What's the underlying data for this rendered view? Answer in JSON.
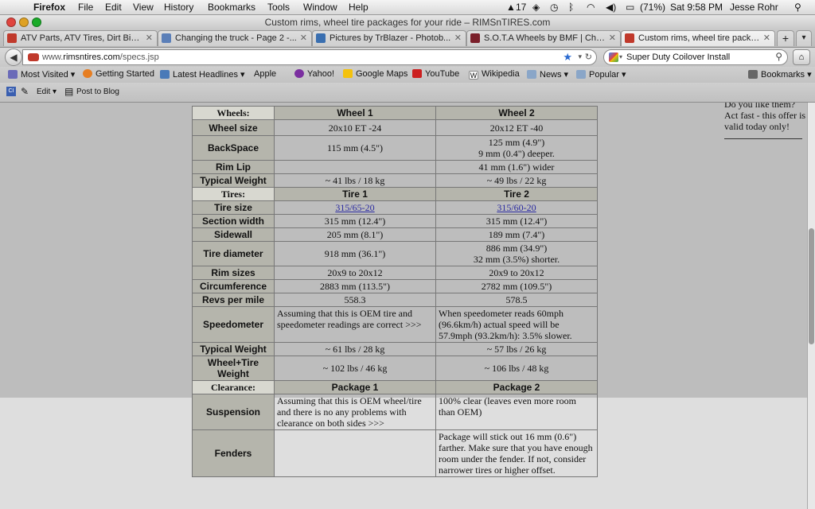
{
  "menubar": {
    "app": "Firefox",
    "items": [
      "File",
      "Edit",
      "View",
      "History",
      "Bookmarks",
      "Tools",
      "Window",
      "Help"
    ],
    "status": {
      "badge": "17",
      "battery": "(71%)",
      "clock": "Sat 9:58 PM",
      "user": "Jesse Rohr"
    }
  },
  "window": {
    "title": "Custom rims, wheel tire packages for your ride – RIMSnTIRES.com"
  },
  "tabs": [
    {
      "label": "ATV Parts, ATV Tires, Dirt Bike...",
      "color": "#c0392b"
    },
    {
      "label": "Changing the truck - Page 2 -...",
      "color": "#5b7fb8"
    },
    {
      "label": "Pictures by TrBlazer - Photob...",
      "color": "#3a6fb0"
    },
    {
      "label": "S.O.T.A Wheels by BMF | Chro...",
      "color": "#7a1f2a"
    },
    {
      "label": "Custom rims, wheel tire packa...",
      "color": "#c0392b"
    }
  ],
  "nav": {
    "url_prefix": "www.",
    "url_domain": "rimsntires.com",
    "url_path": "/specs.jsp",
    "search": "Super Duty Coilover Install"
  },
  "bookmarks": [
    {
      "label": "Most Visited ▾",
      "color": "#6a6ab8"
    },
    {
      "label": "Getting Started",
      "color": "#e67e22"
    },
    {
      "label": "Latest Headlines ▾",
      "color": "#4a7ab8"
    },
    {
      "label": "Apple",
      "color": "#555555"
    },
    {
      "label": "Yahoo!",
      "color": "#7b2fa0"
    },
    {
      "label": "Google Maps",
      "color": "#f4c20d"
    },
    {
      "label": "YouTube",
      "color": "#cc2020"
    },
    {
      "label": "Wikipedia",
      "color": "#ffffff"
    },
    {
      "label": "News ▾",
      "color": "#8aa6c8"
    },
    {
      "label": "Popular ▾",
      "color": "#8aa6c8"
    }
  ],
  "bookmarks_menu": "Bookmarks ▾",
  "toolbar2": {
    "edit": "Edit ▾",
    "post": "Post to Blog"
  },
  "sidebar": {
    "text": "Do you like them? Act fast - this offer is valid today only!"
  },
  "wheels": {
    "section": "Wheels:",
    "col1": "Wheel 1",
    "col2": "Wheel 2",
    "rows": [
      {
        "label": "Wheel size",
        "v1": "20x10 ET -24",
        "v2": "20x12 ET -40"
      },
      {
        "label": "BackSpace",
        "v1": "115 mm (4.5\")",
        "v2": "125 mm (4.9\")",
        "v2b": "9 mm (0.4\") deeper."
      },
      {
        "label": "Rim Lip",
        "v1": "",
        "v2": "41 mm (1.6\") wider"
      },
      {
        "label": "Typical Weight",
        "v1": "~ 41 lbs / 18 kg",
        "v2": "~ 49 lbs / 22 kg"
      }
    ]
  },
  "tires": {
    "section": "Tires:",
    "col1": "Tire 1",
    "col2": "Tire 2",
    "rows": [
      {
        "label": "Tire size",
        "v1": "315/65-20",
        "v2": "315/60-20"
      },
      {
        "label": "Section width",
        "v1": "315 mm (12.4\")",
        "v2": "315 mm (12.4\")"
      },
      {
        "label": "Sidewall",
        "v1": "205 mm (8.1\")",
        "v2": "189 mm (7.4\")"
      },
      {
        "label": "Tire diameter",
        "v1": "918 mm (36.1\")",
        "v2": "886 mm (34.9\")",
        "v2b": "32 mm (3.5%) shorter."
      },
      {
        "label": "Rim sizes",
        "v1": "20x9 to 20x12",
        "v2": "20x9 to 20x12"
      },
      {
        "label": "Circumference",
        "v1": "2883 mm (113.5\")",
        "v2": "2782 mm (109.5\")"
      },
      {
        "label": "Revs per mile",
        "v1": "558.3",
        "v2": "578.5"
      },
      {
        "label": "Speedometer",
        "v1": "Assuming that this is OEM tire and speedometer readings are correct >>>",
        "v2": "When speedometer reads 60mph (96.6km/h) actual speed will be 57.9mph (93.2km/h): 3.5% slower."
      },
      {
        "label": "Typical Weight",
        "v1": "~ 61 lbs / 28 kg",
        "v2": "~ 57 lbs / 26 kg"
      },
      {
        "label": "Wheel+Tire Weight",
        "v1": "~ 102 lbs / 46 kg",
        "v2": "~ 106 lbs / 48 kg"
      }
    ]
  },
  "clearance": {
    "section": "Clearance:",
    "col1": "Package 1",
    "col2": "Package 2",
    "rows": [
      {
        "label": "Suspension",
        "v1": "Assuming that this is OEM wheel/tire and there is no any problems with clearance on both sides >>>",
        "v2": "100% clear (leaves even more room than OEM)"
      },
      {
        "label": "Fenders",
        "v1": "",
        "v2": "Package will stick out 16 mm (0.6\") farther. Make sure that you have enough room under the fender. If not, consider narrower tires or higher offset."
      }
    ]
  }
}
